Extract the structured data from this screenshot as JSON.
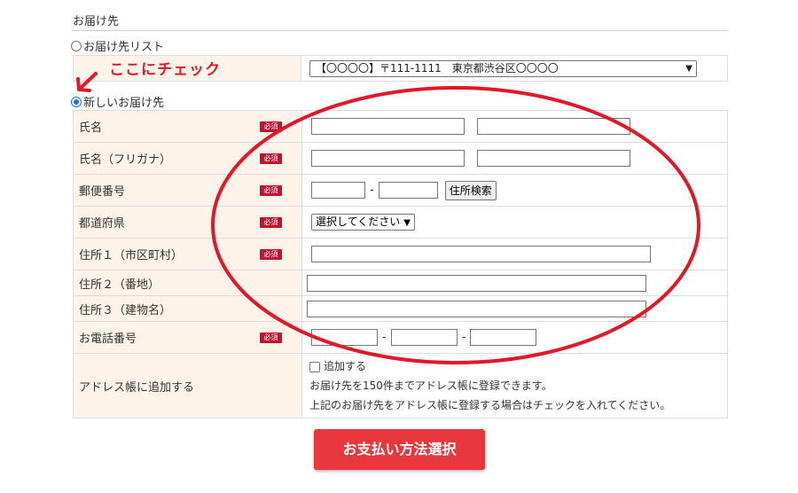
{
  "section": {
    "title": "お届け先"
  },
  "options": {
    "list_label": "お届け先リスト",
    "list_selected": "【〇〇〇〇】〒111-1111　東京都渋谷区〇〇〇〇",
    "new_label": "新しいお届け先"
  },
  "annotation": {
    "callout": "ここにチェック",
    "color": "#e0182a"
  },
  "form": {
    "required_badge": "必須",
    "rows": {
      "name": "氏名",
      "kana": "氏名（フリガナ）",
      "postal": "郵便番号",
      "prefecture": "都道府県",
      "address1": "住所１（市区町村）",
      "address2": "住所２（番地）",
      "address3": "住所３（建物名）",
      "phone": "お電話番号",
      "addressbook": "アドレス帳に追加する"
    },
    "postal_dash": "-",
    "phone_dash": "-",
    "search_button": "住所検索",
    "prefecture_select": "選択してください",
    "add_checkbox_label": "追加する",
    "note1": "お届け先を150件までアドレス帳に登録できます。",
    "note2": "上記のお届け先をアドレス帳に登録する場合はチェックを入れてください。"
  },
  "submit": {
    "label": "お支払い方法選択",
    "color": "#e8383d"
  },
  "icons": {
    "arrow": "arrow-down-left-icon",
    "chevron": "chevron-down-icon"
  }
}
